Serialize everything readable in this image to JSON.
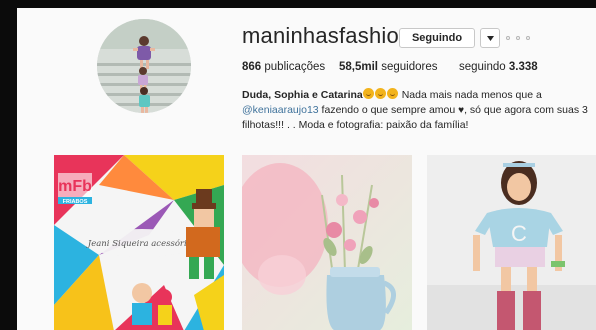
{
  "profile": {
    "username": "maninhasfashion",
    "follow_button_label": "Seguindo",
    "dropdown_icon": "caret-down-icon",
    "more_icon": "more-options-icon"
  },
  "stats": {
    "posts_count": "866",
    "posts_label": "publicações",
    "followers_count": "58,5mil",
    "followers_label": "seguidores",
    "following_label": "seguindo",
    "following_count": "3.338"
  },
  "bio": {
    "name": "Duda, Sophia e Catarina",
    "text_before_mention": " Nada mais nada menos que a ",
    "mention": "@keniaaraujo13",
    "text_after_mention": " fazendo o que sempre amou ",
    "text_after_heart": ", só que agora com suas 3 filhotas!!! . . Moda e fotografia: paixão da família!"
  },
  "posts": [
    {
      "logo_text": "mFb",
      "logo_subtext": "FRIABOS",
      "caption": "Jeani Siqueira acessórios"
    },
    {},
    {}
  ],
  "colors": {
    "mention": "#3f729b",
    "page_background": "#fafafa",
    "border": "#c8c8c8"
  }
}
